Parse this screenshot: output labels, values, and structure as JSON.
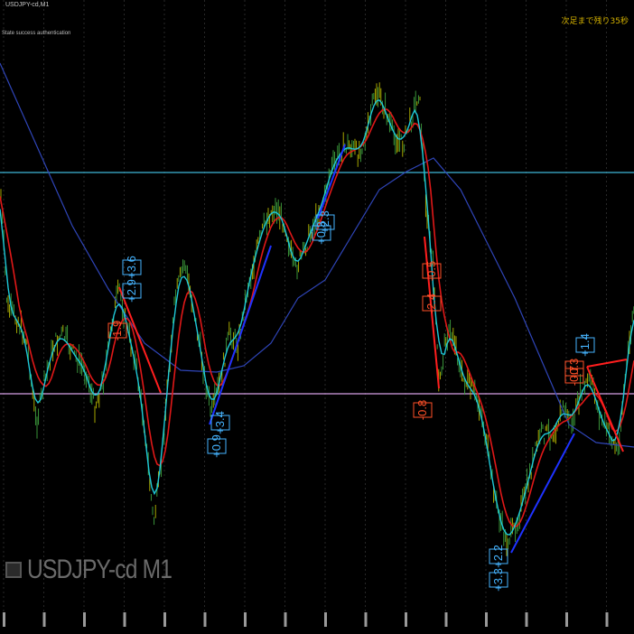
{
  "header": {
    "symbol_label": "USDJPY-cd,M1",
    "status_text": "State success authentication",
    "right_label": "次足まで残り35秒"
  },
  "watermark": {
    "text": "USDJPY-cd M1"
  },
  "colors": {
    "background": "#000000",
    "candle": "#3fa33f",
    "ma_fast": "#1ec8d8",
    "ma_slow": "#e01818",
    "ma_long": "#2f45b8",
    "line_cyan": "#3fb7d8",
    "line_pink": "#d7a0e6",
    "trend_up": "#1e32ff",
    "trend_down": "#ff1e1e",
    "tag_blue": "#46b4ff",
    "tag_red": "#ff5028"
  },
  "trade_tags": [
    {
      "text": "+3.6",
      "color": "blue"
    },
    {
      "text": "+2.9",
      "color": "blue"
    },
    {
      "text": "-1.9",
      "color": "red"
    },
    {
      "text": "+3.4",
      "color": "blue"
    },
    {
      "text": "+0.9",
      "color": "blue"
    },
    {
      "text": "+2.3",
      "color": "blue"
    },
    {
      "text": "+0.3",
      "color": "blue"
    },
    {
      "text": "-0.5",
      "color": "red"
    },
    {
      "text": "-2.4",
      "color": "red"
    },
    {
      "text": "-0.8",
      "color": "red"
    },
    {
      "text": "+2.2",
      "color": "blue"
    },
    {
      "text": "+3.3",
      "color": "blue"
    },
    {
      "text": "+1.4",
      "color": "blue"
    },
    {
      "text": "-0.3",
      "color": "red"
    },
    {
      "text": "-0.7",
      "color": "red"
    }
  ]
}
